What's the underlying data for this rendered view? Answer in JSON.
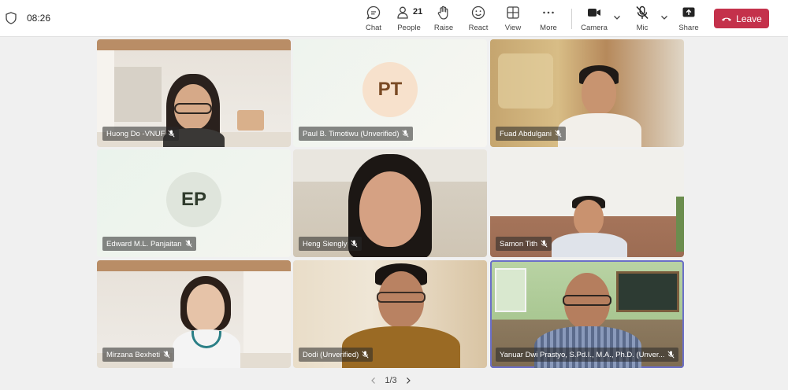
{
  "topbar": {
    "time": "08:26",
    "chat_label": "Chat",
    "people_label": "People",
    "people_count": "21",
    "raise_label": "Raise",
    "react_label": "React",
    "view_label": "View",
    "more_label": "More",
    "camera_label": "Camera",
    "mic_label": "Mic",
    "share_label": "Share",
    "leave_label": "Leave"
  },
  "participants": [
    {
      "name": "Huong Do -VNUF",
      "muted": true,
      "type": "video"
    },
    {
      "name": "Paul B. Timotiwu (Unverified)",
      "muted": true,
      "type": "avatar",
      "initials": "PT"
    },
    {
      "name": "Fuad Abdulgani",
      "muted": true,
      "type": "video"
    },
    {
      "name": "Edward M.L. Panjaitan",
      "muted": true,
      "type": "avatar",
      "initials": "EP"
    },
    {
      "name": "Heng Siengly",
      "muted": true,
      "type": "video"
    },
    {
      "name": "Samon Tith",
      "muted": true,
      "type": "video"
    },
    {
      "name": "Mirzana Bexheti",
      "muted": true,
      "type": "video"
    },
    {
      "name": "Dodi (Unverified)",
      "muted": true,
      "type": "video"
    },
    {
      "name": "Yanuar Dwi Prastyo, S.Pd.I., M.A., Ph.D. (Unver...",
      "muted": true,
      "type": "video",
      "active": true
    }
  ],
  "pager": {
    "label": "1/3"
  },
  "colors": {
    "leave": "#c4314b",
    "active_outline": "#6b6fc8",
    "avatar_pt": "#f7e1cc",
    "avatar_ep": "#dfe5dc"
  }
}
